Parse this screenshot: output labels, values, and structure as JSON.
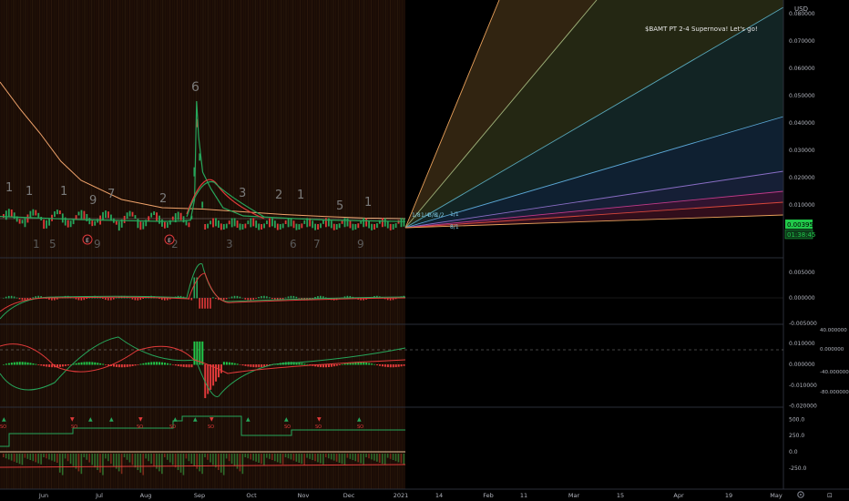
{
  "chart_data": [
    {
      "type": "line",
      "panel": "price",
      "currency": "USD",
      "annotation": "$BAMT PT 2-4 Supernova!  Let's go!",
      "y_ticks": [
        "0.080000",
        "0.070000",
        "0.060000",
        "0.050000",
        "0.040000",
        "0.030000",
        "0.020000",
        "0.010000"
      ],
      "ylim": [
        0,
        0.085
      ],
      "last_price": "0.003950",
      "countdown": "01:38:45",
      "fib_labels": [
        "1/8",
        "1/4",
        "3/8",
        "1/2",
        "1/1",
        "8/1"
      ],
      "price_series": [
        {
          "x": 0,
          "y": 0.0058
        },
        {
          "x": 0.1,
          "y": 0.0052
        },
        {
          "x": 0.2,
          "y": 0.0046
        },
        {
          "x": 0.3,
          "y": 0.0043
        },
        {
          "x": 0.4,
          "y": 0.004
        },
        {
          "x": 0.45,
          "y": 0.0041
        },
        {
          "x": 0.47,
          "y": 0.0044
        },
        {
          "x": 0.48,
          "y": 0.012
        },
        {
          "x": 0.485,
          "y": 0.048
        },
        {
          "x": 0.49,
          "y": 0.035
        },
        {
          "x": 0.5,
          "y": 0.022
        },
        {
          "x": 0.52,
          "y": 0.016
        },
        {
          "x": 0.55,
          "y": 0.009
        },
        {
          "x": 0.6,
          "y": 0.006
        },
        {
          "x": 0.7,
          "y": 0.0052
        },
        {
          "x": 0.8,
          "y": 0.0045
        },
        {
          "x": 0.9,
          "y": 0.0042
        },
        {
          "x": 1.0,
          "y": 0.00395
        }
      ],
      "ma_series": [
        {
          "x": 0,
          "y": 0.055
        },
        {
          "x": 0.05,
          "y": 0.045
        },
        {
          "x": 0.1,
          "y": 0.036
        },
        {
          "x": 0.15,
          "y": 0.026
        },
        {
          "x": 0.2,
          "y": 0.019
        },
        {
          "x": 0.3,
          "y": 0.012
        },
        {
          "x": 0.4,
          "y": 0.009
        },
        {
          "x": 0.5,
          "y": 0.0085
        },
        {
          "x": 0.6,
          "y": 0.0075
        },
        {
          "x": 0.7,
          "y": 0.0065
        },
        {
          "x": 0.8,
          "y": 0.0058
        },
        {
          "x": 0.9,
          "y": 0.0052
        },
        {
          "x": 1.0,
          "y": 0.005
        }
      ],
      "top_markers": [
        "1",
        "1",
        "1",
        "9",
        "7",
        "2",
        "6",
        "3",
        "2",
        "1",
        "5",
        "1"
      ],
      "bottom_markers": [
        "1",
        "5",
        "9",
        "2",
        "3",
        "6",
        "7",
        "9"
      ],
      "earnings_badges": [
        "E",
        "E"
      ]
    },
    {
      "type": "line",
      "panel": "oscillator-1",
      "y_ticks": [
        "0.005000",
        "0.000000",
        "-0.005000"
      ],
      "ylim": [
        -0.0065,
        0.008
      ]
    },
    {
      "type": "bar",
      "panel": "oscillator-2",
      "y_ticks": [
        "0.010000",
        "0.000000",
        "-0.010000",
        "-0.020000"
      ],
      "y_ticks_secondary": [
        "40.000000",
        "0.000000",
        "-40.000000",
        "-80.000000"
      ],
      "ylim": [
        -0.022,
        0.014
      ]
    },
    {
      "type": "line",
      "panel": "oscillator-3",
      "y_ticks": [
        "500.0",
        "250.0",
        "0.0",
        "-250.0"
      ],
      "ylim": [
        -300,
        560
      ],
      "signal_labels": [
        "SO",
        "SO",
        "SO",
        "SO",
        "SO",
        "SO",
        "SO",
        "SO"
      ]
    }
  ],
  "x_axis": {
    "labels": [
      "Jun",
      "Jul",
      "Aug",
      "Sep",
      "Oct",
      "Nov",
      "Dec",
      "2021",
      "14",
      "Feb",
      "11",
      "Mar",
      "15",
      "Apr",
      "19",
      "May"
    ]
  },
  "colors": {
    "background": "#000000",
    "up": "#26a65b",
    "down": "#e03a3a",
    "ma": "#f0a36b",
    "last_price_bg": "#21c84a",
    "fan": [
      "#e8a05a",
      "#9fb27a",
      "#58a6b8",
      "#5ba7d6",
      "#8a6ec6",
      "#c23a8a",
      "#d9473b",
      "#e8a05a"
    ]
  },
  "ui": {
    "settings_icon": "gear-icon",
    "chart_type_icon": "candles-icon"
  }
}
